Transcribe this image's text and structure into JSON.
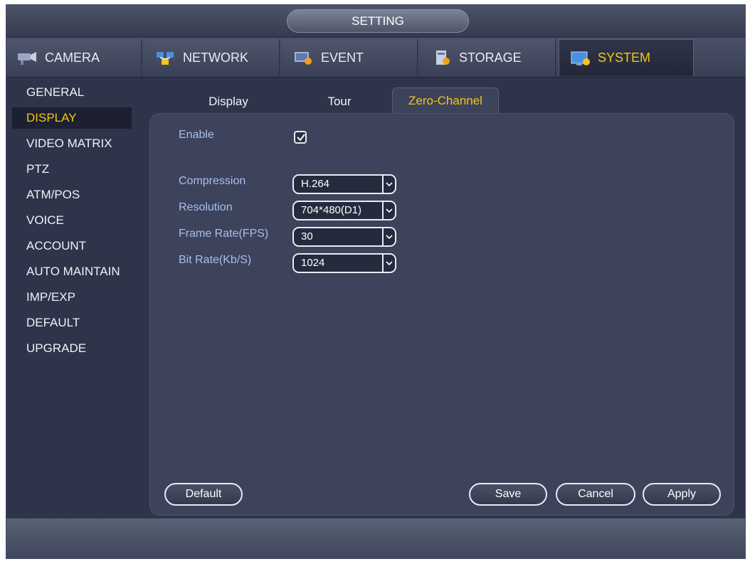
{
  "window": {
    "title": "SETTING"
  },
  "top_tabs": [
    {
      "label": "CAMERA",
      "icon": "camera-icon"
    },
    {
      "label": "NETWORK",
      "icon": "network-icon"
    },
    {
      "label": "EVENT",
      "icon": "event-icon"
    },
    {
      "label": "STORAGE",
      "icon": "storage-icon"
    },
    {
      "label": "SYSTEM",
      "icon": "system-icon",
      "active": true
    }
  ],
  "sidebar": {
    "items": [
      {
        "label": "GENERAL"
      },
      {
        "label": "DISPLAY",
        "active": true
      },
      {
        "label": "VIDEO MATRIX"
      },
      {
        "label": "PTZ"
      },
      {
        "label": "ATM/POS"
      },
      {
        "label": "VOICE"
      },
      {
        "label": "ACCOUNT"
      },
      {
        "label": "AUTO MAINTAIN"
      },
      {
        "label": "IMP/EXP"
      },
      {
        "label": "DEFAULT"
      },
      {
        "label": "UPGRADE"
      }
    ]
  },
  "sub_tabs": [
    {
      "label": "Display"
    },
    {
      "label": "Tour"
    },
    {
      "label": "Zero-Channel",
      "active": true
    }
  ],
  "form": {
    "enable": {
      "label": "Enable",
      "checked": true
    },
    "compression": {
      "label": "Compression",
      "value": "H.264"
    },
    "resolution": {
      "label": "Resolution",
      "value": "704*480(D1)"
    },
    "frame_rate": {
      "label": "Frame Rate(FPS)",
      "value": "30"
    },
    "bit_rate": {
      "label": "Bit Rate(Kb/S)",
      "value": "1024"
    }
  },
  "buttons": {
    "default": "Default",
    "save": "Save",
    "cancel": "Cancel",
    "apply": "Apply"
  },
  "colors": {
    "accent": "#f5c518",
    "label": "#a8bff0",
    "background": "#2e344a"
  }
}
